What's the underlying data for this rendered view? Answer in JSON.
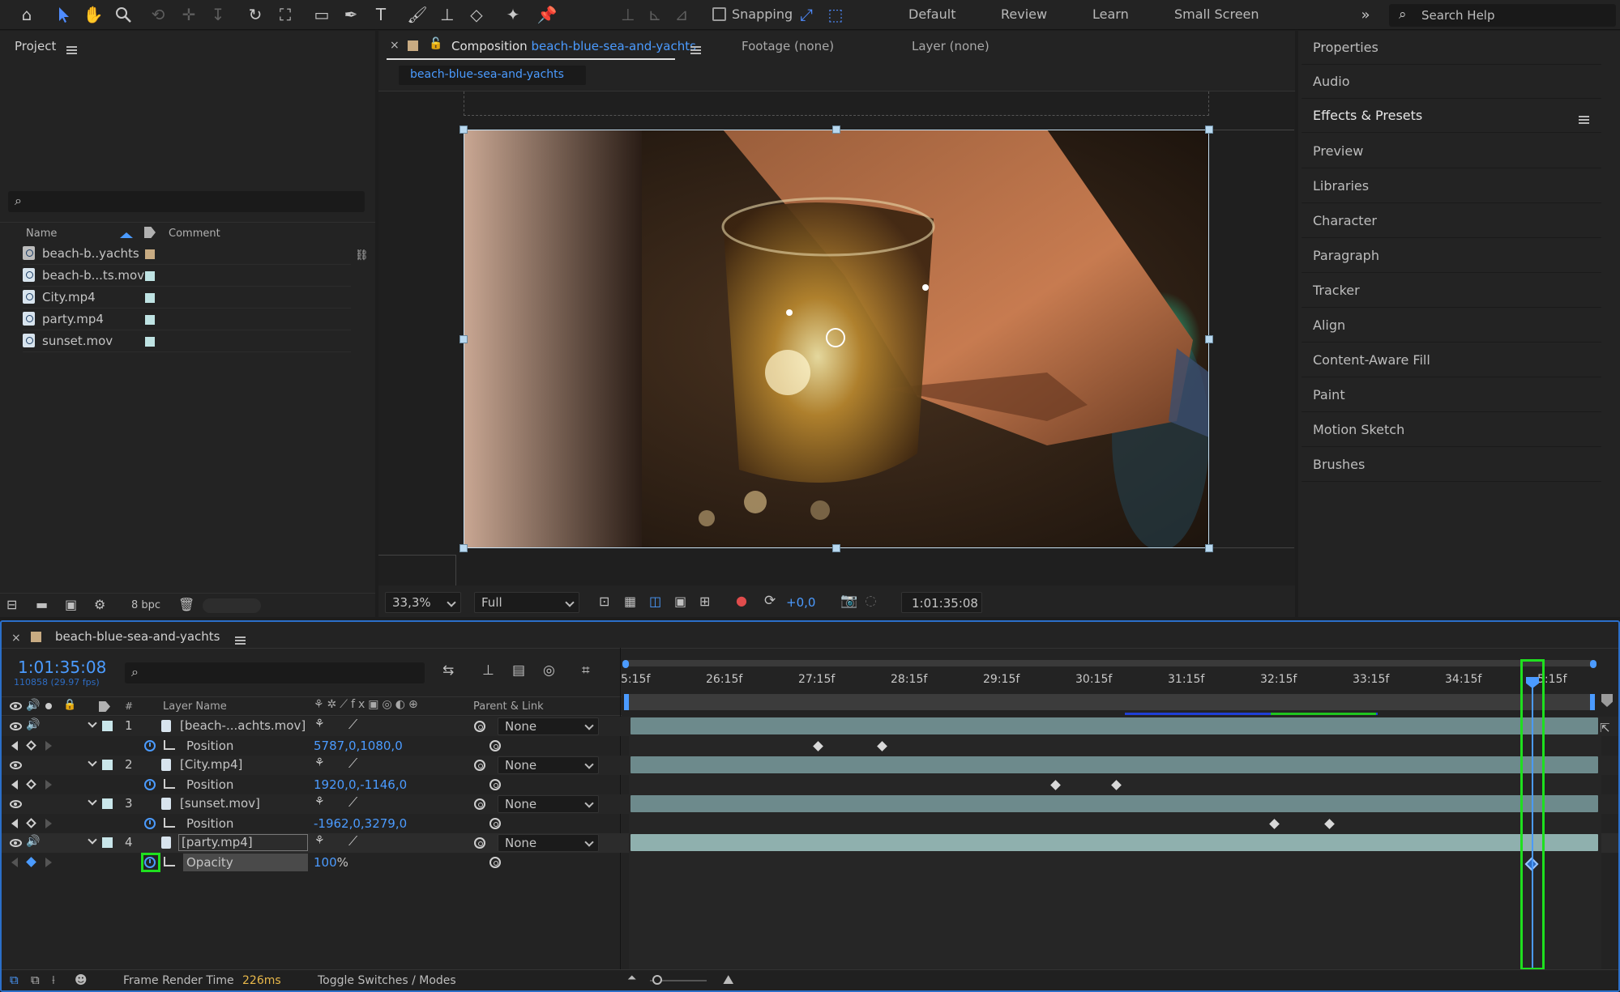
{
  "toolbar": {
    "snapping_label": "Snapping",
    "workspaces": [
      "Default",
      "Review",
      "Learn",
      "Small Screen"
    ],
    "search_placeholder": "Search Help"
  },
  "project": {
    "title": "Project",
    "columns": {
      "name": "Name",
      "comment": "Comment"
    },
    "items": [
      {
        "name": "beach-b..yachts",
        "label_color": "#c8ab82",
        "type": "composition"
      },
      {
        "name": "beach-b...ts.mov",
        "label_color": "#bfe3e3",
        "type": "footage"
      },
      {
        "name": "City.mp4",
        "label_color": "#bfe3e3",
        "type": "footage"
      },
      {
        "name": "party.mp4",
        "label_color": "#bfe3e3",
        "type": "footage"
      },
      {
        "name": "sunset.mov",
        "label_color": "#bfe3e3",
        "type": "footage"
      }
    ],
    "bpc": "8 bpc"
  },
  "composition": {
    "tab_prefix": "Composition",
    "tab_name": "beach-blue-sea-and-yachts",
    "footage_tab": "Footage (none)",
    "layer_tab": "Layer (none)",
    "comp_chip": "beach-blue-sea-and-yachts",
    "zoom": "33,3%",
    "resolution": "Full",
    "exposure": "+0,0",
    "timecode": "1:01:35:08"
  },
  "right_panel": {
    "items": [
      "Properties",
      "Audio",
      "Effects & Presets",
      "Preview",
      "Libraries",
      "Character",
      "Paragraph",
      "Tracker",
      "Align",
      "Content-Aware Fill",
      "Paint",
      "Motion Sketch",
      "Brushes"
    ]
  },
  "timeline": {
    "comp_name": "beach-blue-sea-and-yachts",
    "current_time": "1:01:35:08",
    "frame_info": "110858 (29.97 fps)",
    "columns": {
      "number": "#",
      "layer_name": "Layer Name",
      "parent": "Parent & Link"
    },
    "ruler_labels": [
      "5:15f",
      "26:15f",
      "27:15f",
      "28:15f",
      "29:15f",
      "30:15f",
      "31:15f",
      "32:15f",
      "33:15f",
      "34:15f",
      "5:15f"
    ],
    "layers": [
      {
        "index": "1",
        "name": "[beach-...achts.mov]",
        "parent": "None",
        "property": "Position",
        "value": "5787,0,1080,0"
      },
      {
        "index": "2",
        "name": "[City.mp4]",
        "parent": "None",
        "property": "Position",
        "value": "1920,0,-1146,0"
      },
      {
        "index": "3",
        "name": "[sunset.mov]",
        "parent": "None",
        "property": "Position",
        "value": "-1962,0,3279,0"
      },
      {
        "index": "4",
        "name": "[party.mp4]",
        "parent": "None",
        "property": "Opacity",
        "value_number": "100",
        "value_unit": "%"
      }
    ],
    "footer": {
      "render_label": "Frame Render Time",
      "render_value": "226ms",
      "toggle_label": "Toggle Switches / Modes"
    }
  }
}
